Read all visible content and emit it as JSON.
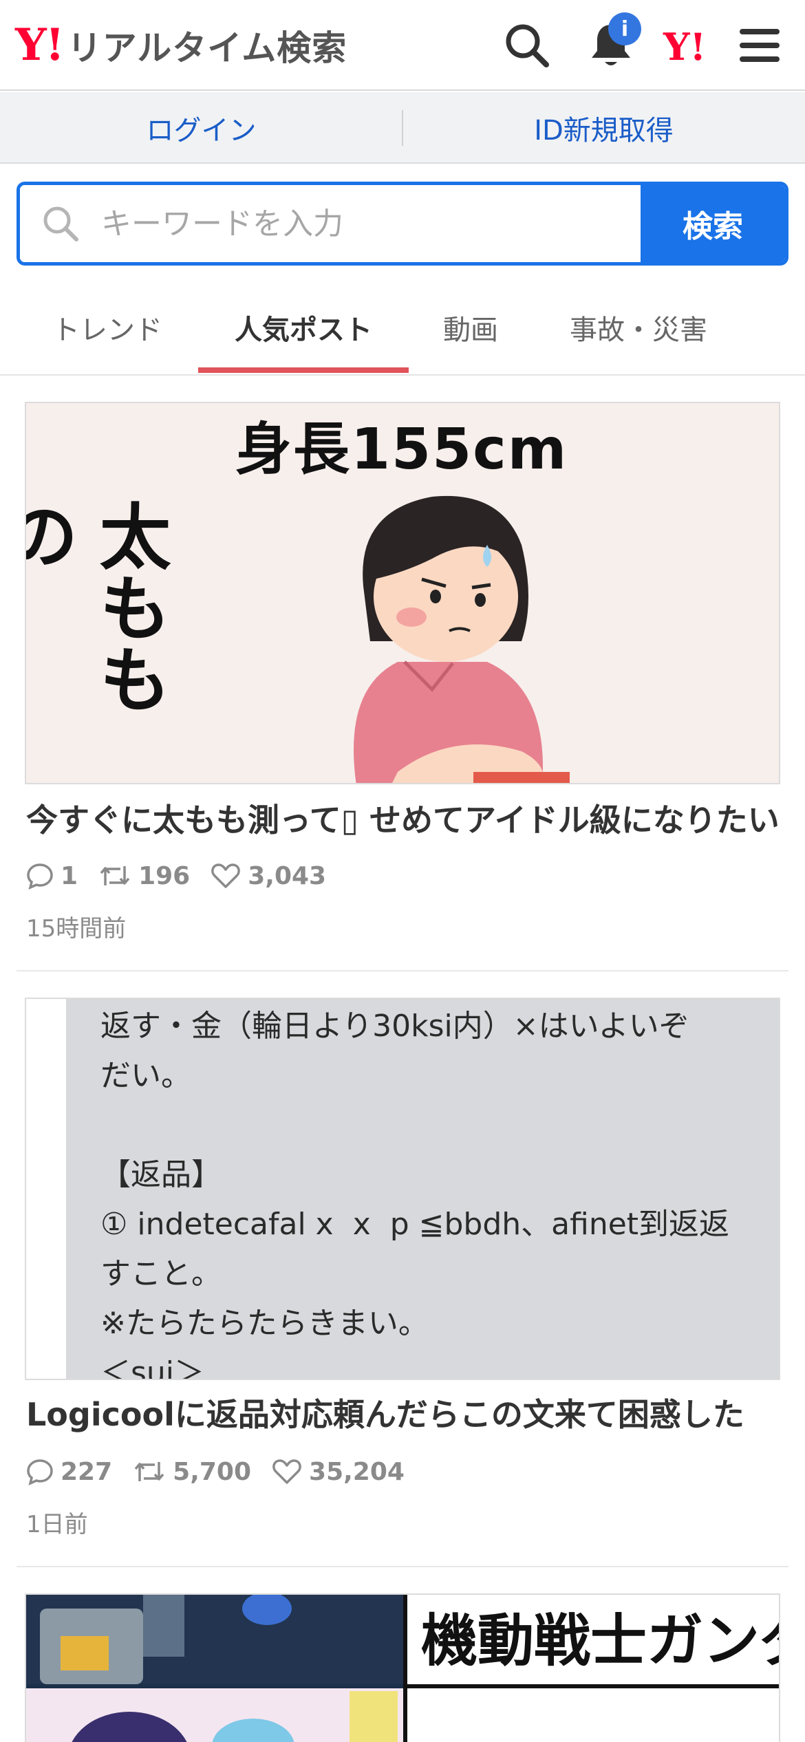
{
  "header": {
    "logo_y": "Y!",
    "logo_text": "リアルタイム検索",
    "notification_badge": "i",
    "yahoo_mark": "Y!"
  },
  "account": {
    "login_label": "ログイン",
    "signup_label": "ID新規取得"
  },
  "search": {
    "placeholder": "キーワードを入力",
    "button_label": "検索"
  },
  "tabs": [
    {
      "label": "トレンド",
      "active": false
    },
    {
      "label": "人気ポスト",
      "active": true
    },
    {
      "label": "動画",
      "active": false
    },
    {
      "label": "事故・災害",
      "active": false
    }
  ],
  "posts": [
    {
      "title": "今すぐに太もも測って▯ せめてアイドル級になりたい",
      "replies": "1",
      "reposts": "196",
      "likes": "3,043",
      "time": "15時間前",
      "image_text_top": "身長155cm",
      "image_text_vertical": "太ももの"
    },
    {
      "title": "Logicoolに返品対応頼んだらこの文来て困惑した",
      "replies": "227",
      "reposts": "5,700",
      "likes": "35,204",
      "time": "1日前",
      "image_text": "返す・金（輪日より30ksi内）×はいよいぞ\nだい。\n\n【返品】\n① indetecafal x  x  p ≦bbdh、afinet到返返\nすこと。\n※たらたらたらきまい。\n＜sui＞"
    },
    {
      "image_text": "機動戦士ガンダ"
    }
  ],
  "colors": {
    "brand_red": "#ff0033",
    "accent_blue": "#1a73e8",
    "link_blue": "#1a5dc8",
    "tab_underline": "#e0535b",
    "badge_blue": "#3476e0"
  }
}
